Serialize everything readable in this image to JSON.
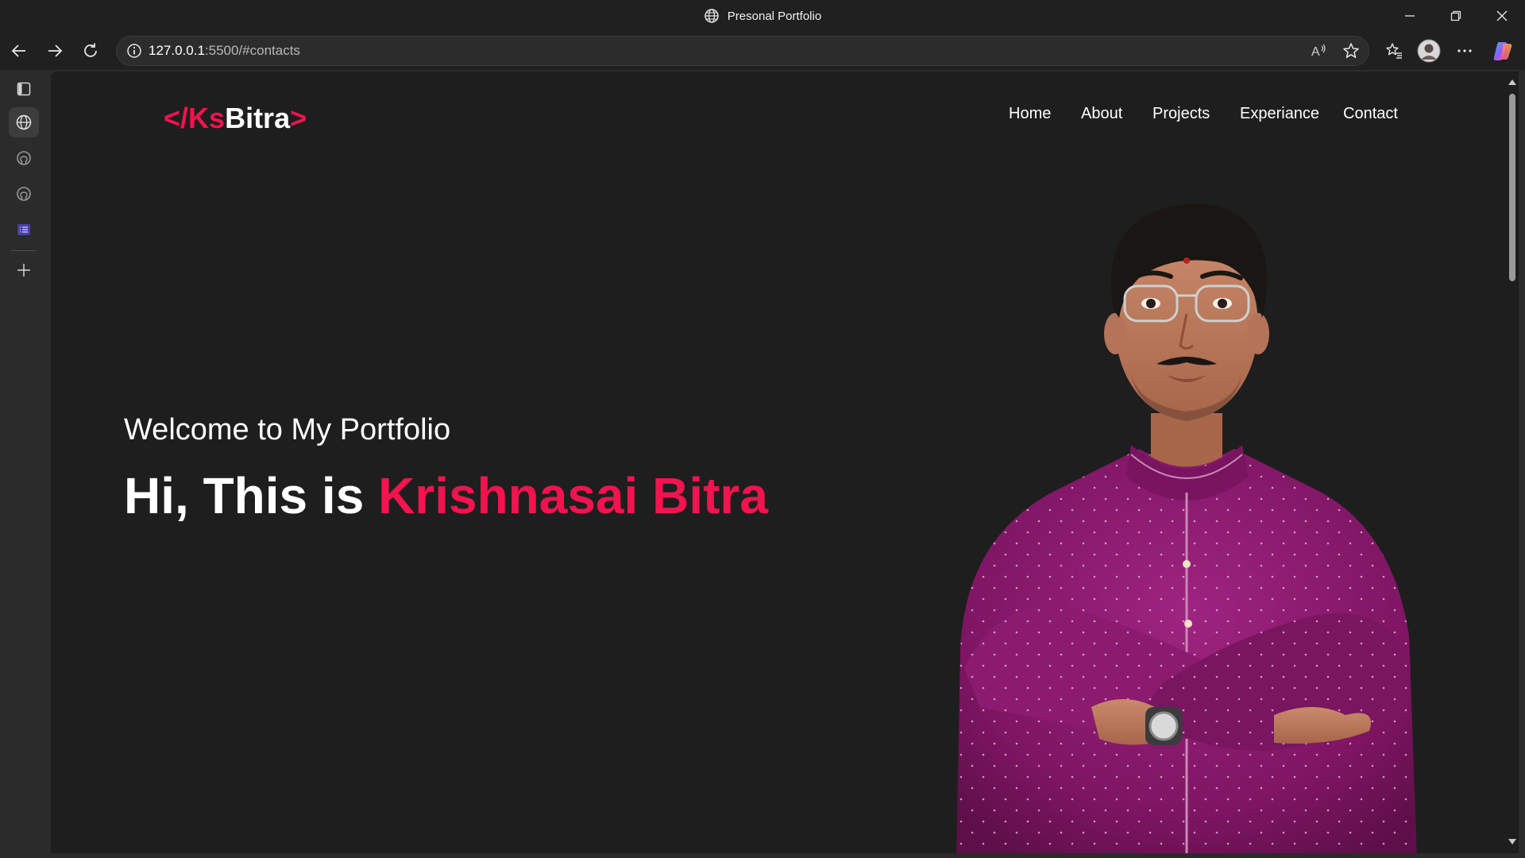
{
  "window": {
    "title": "Presonal Portfolio"
  },
  "toolbar": {
    "url_host": "127.0.0.1",
    "url_rest": ":5500/#contacts"
  },
  "page": {
    "logo": {
      "open": "</",
      "ks": "Ks",
      "b": "B",
      "itra": "itra",
      "close": ">"
    },
    "nav": [
      "Home",
      "About",
      "Projects",
      "Experiance",
      "Contact"
    ],
    "welcome": "Welcome to My Portfolio",
    "greeting": "Hi, This is",
    "name": "Krishnasai Bitra"
  },
  "colors": {
    "accent": "#f3134f",
    "background": "#1e1e1e",
    "kurta": "#8e1a6e"
  },
  "icons": {
    "sidebar": [
      "sidebar-toggle-icon",
      "globe-icon",
      "github-icon",
      "github-icon",
      "list-icon",
      "plus-icon"
    ]
  }
}
